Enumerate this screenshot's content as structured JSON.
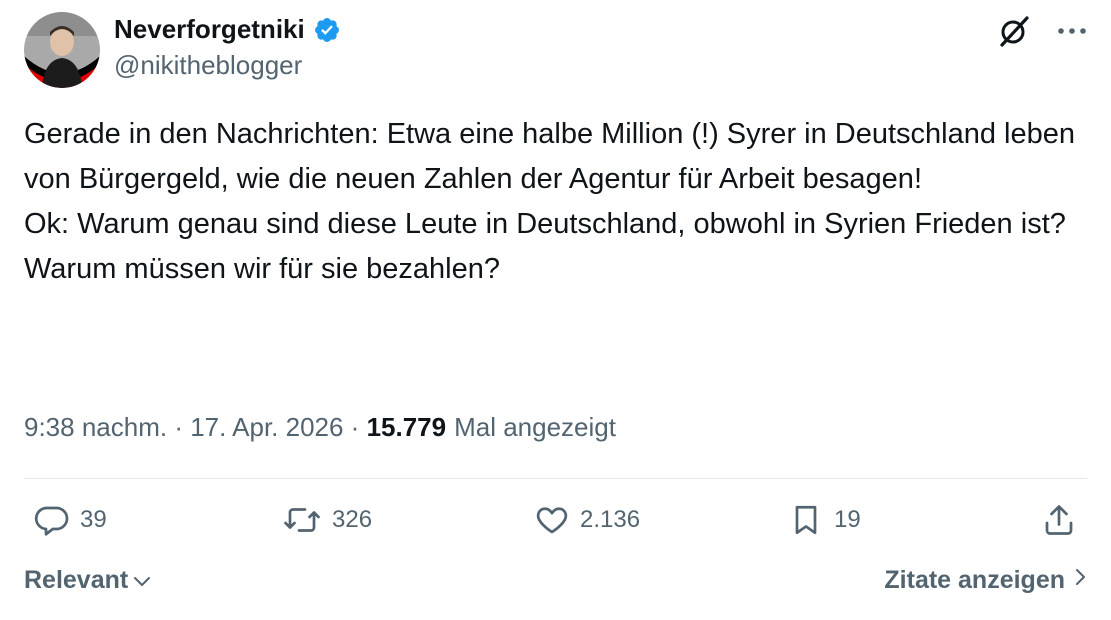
{
  "author": {
    "display_name": "Neverforgetniki",
    "handle": "@nikitheblogger",
    "verified": true,
    "avatar_icon": "profile-photo-with-german-flag-ring"
  },
  "tweet": {
    "text": "Gerade in den Nachrichten: Etwa eine halbe Million (!) Syrer in Deutschland leben von Bürgergeld, wie die neuen Zahlen der Agentur für Arbeit besagen!\nOk: Warum genau sind diese Leute in Deutschland, obwohl in Syrien Frieden ist?\nWarum müssen wir für sie bezahlen?",
    "time": "9:38 nachm.",
    "separator": " · ",
    "date": "17. Apr. 2026",
    "views_count": "15.779",
    "views_label": "Mal angezeigt"
  },
  "actions": {
    "replies": "39",
    "reposts": "326",
    "likes": "2.136",
    "bookmarks": "19"
  },
  "footer": {
    "sort_label": "Relevant",
    "quotes_label": "Zitate anzeigen"
  },
  "colors": {
    "text_primary": "#0f1419",
    "text_secondary": "#536471",
    "verified_blue": "#1d9bf0",
    "divider": "#e6e9ec"
  }
}
